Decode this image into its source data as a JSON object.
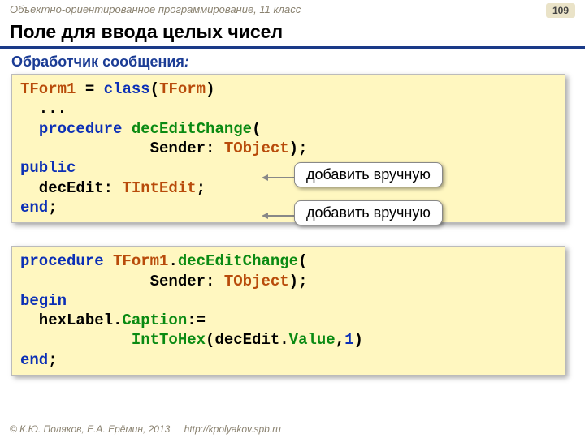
{
  "header": {
    "course": "Объектно-ориентированное программирование, 11 класс",
    "page": "109"
  },
  "title": "Поле для ввода целых чисел",
  "subtitle": {
    "label": "Обработчик сообщения",
    "colon": ":"
  },
  "code1": {
    "l1a": "TForm1",
    "l1b": " = ",
    "l1c": "class",
    "l1d": "(",
    "l1e": "TForm",
    "l1f": ")",
    "l2": "  ...",
    "l3a": "  ",
    "l3b": "procedure",
    "l3c": " ",
    "l3d": "decEditChange",
    "l3e": "(",
    "l4a": "              Sender: ",
    "l4b": "TObject",
    "l4c": ");",
    "l5": "public",
    "l6a": "  decEdit: ",
    "l6b": "TIntEdit",
    "l6c": ";",
    "l7a": "end",
    "l7b": ";"
  },
  "callout1": "добавить вручную",
  "callout2": "добавить вручную",
  "code2": {
    "l1a": "procedure",
    "l1b": " ",
    "l1c": "TForm1",
    "l1d": ".",
    "l1e": "decEditChange",
    "l1f": "(",
    "l2a": "              Sender: ",
    "l2b": "TObject",
    "l2c": ");",
    "l3": "begin",
    "l4a": "  hexLabel.",
    "l4b": "Caption",
    "l4c": ":=",
    "l5a": "            ",
    "l5b": "IntToHex",
    "l5c": "(decEdit.",
    "l5d": "Value",
    "l5e": ",",
    "l5f": "1",
    "l5g": ")",
    "l6a": "end",
    "l6b": ";"
  },
  "footer": {
    "copyright": "© К.Ю. Поляков, Е.А. Ерёмин, 2013",
    "url": "http://kpolyakov.spb.ru"
  }
}
